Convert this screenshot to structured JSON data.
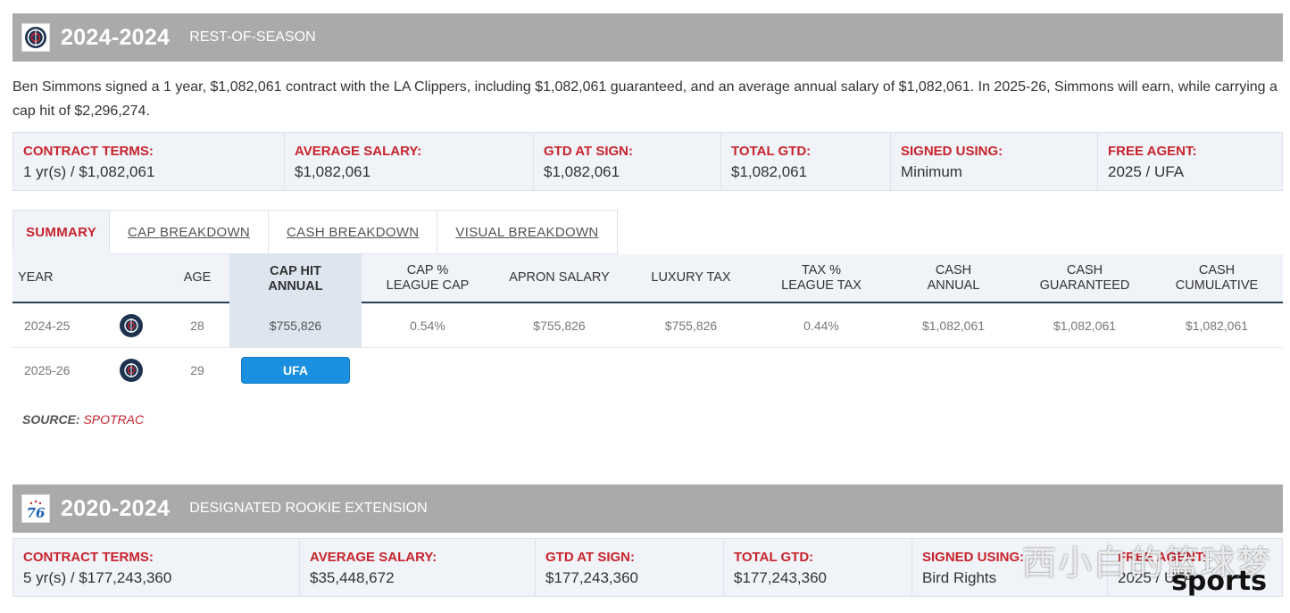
{
  "contract1": {
    "years": "2024-2024",
    "type": "REST-OF-SEASON",
    "logo_icon": "clippers-logo-icon",
    "description": "Ben Simmons signed a 1 year, $1,082,061 contract with the LA Clippers, including $1,082,061 guaranteed, and an average annual salary of $1,082,061. In 2025-26, Simmons will earn, while carrying a cap hit of $2,296,274.",
    "terms": [
      {
        "label": "CONTRACT TERMS:",
        "value": "1 yr(s) / $1,082,061"
      },
      {
        "label": "AVERAGE SALARY:",
        "value": "$1,082,061"
      },
      {
        "label": "GTD AT SIGN:",
        "value": "$1,082,061"
      },
      {
        "label": "TOTAL GTD:",
        "value": "$1,082,061"
      },
      {
        "label": "SIGNED USING:",
        "value": "Minimum"
      },
      {
        "label": "FREE AGENT:",
        "value": "2025 / UFA"
      }
    ]
  },
  "tabs": [
    {
      "label": "SUMMARY"
    },
    {
      "label": "CAP BREAKDOWN"
    },
    {
      "label": "CASH BREAKDOWN"
    },
    {
      "label": "VISUAL BREAKDOWN"
    }
  ],
  "table": {
    "headers": {
      "year": "YEAR",
      "age": "AGE",
      "cap_hit_1": "CAP HIT",
      "cap_hit_2": "ANNUAL",
      "cap_pct_1": "CAP %",
      "cap_pct_2": "LEAGUE CAP",
      "apron": "APRON SALARY",
      "luxury": "LUXURY TAX",
      "tax_pct_1": "TAX %",
      "tax_pct_2": "LEAGUE TAX",
      "cash_annual_1": "CASH",
      "cash_annual_2": "ANNUAL",
      "cash_gtd_1": "CASH",
      "cash_gtd_2": "GUARANTEED",
      "cash_cum_1": "CASH",
      "cash_cum_2": "CUMULATIVE"
    },
    "rows": [
      {
        "year": "2024-25",
        "age": "28",
        "cap_hit": "$755,826",
        "cap_pct": "0.54%",
        "apron": "$755,826",
        "luxury": "$755,826",
        "tax_pct": "0.44%",
        "cash_annual": "$1,082,061",
        "cash_gtd": "$1,082,061",
        "cash_cum": "$1,082,061"
      },
      {
        "year": "2025-26",
        "age": "29",
        "badge": "UFA"
      }
    ]
  },
  "source": {
    "label": "SOURCE:",
    "name": "SPOTRAC"
  },
  "contract2": {
    "years": "2020-2024",
    "type": "DESIGNATED ROOKIE EXTENSION",
    "logo_text": "76",
    "terms": [
      {
        "label": "CONTRACT TERMS:",
        "value": "5 yr(s) / $177,243,360"
      },
      {
        "label": "AVERAGE SALARY:",
        "value": "$35,448,672"
      },
      {
        "label": "GTD AT SIGN:",
        "value": "$177,243,360"
      },
      {
        "label": "TOTAL GTD:",
        "value": "$177,243,360"
      },
      {
        "label": "SIGNED USING:",
        "value": "Bird Rights"
      },
      {
        "label": "FREE AGENT:",
        "value": "2025 / UFA"
      }
    ]
  },
  "watermark": {
    "cn": "西小白的篮球梦",
    "en": "sports"
  },
  "colors": {
    "accent_red": "#c8232c",
    "header_gray": "#aaaaaa",
    "ufa_blue": "#1b8fe0",
    "navy": "#2e3f55"
  }
}
